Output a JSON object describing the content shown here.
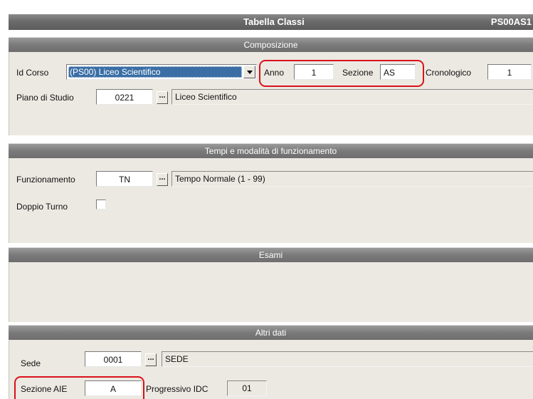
{
  "window": {
    "title": "Tabella Classi",
    "code": "PS00AS1"
  },
  "sections": {
    "composizione": "Composizione",
    "tempi": "Tempi e modalità di funzionamento",
    "esami": "Esami",
    "altri": "Altri dati"
  },
  "composizione": {
    "id_corso_label": "Id Corso",
    "id_corso_value": "(PS00) Liceo Scientifico",
    "anno_label": "Anno",
    "anno_value": "1",
    "sezione_label": "Sezione",
    "sezione_value": "AS",
    "cronologico_label": "Cronologico",
    "cronologico_value": "1",
    "piano_label": "Piano di Studio",
    "piano_code": "0221",
    "piano_desc": "Liceo Scientifico"
  },
  "tempi": {
    "funz_label": "Funzionamento",
    "funz_code": "TN",
    "funz_desc": "Tempo Normale (1 - 99)",
    "doppio_label": "Doppio Turno",
    "doppio_checked": false
  },
  "altri": {
    "sede_label": "Sede",
    "sede_code": "0001",
    "sede_desc": "SEDE",
    "sezione_aie_label": "Sezione AIE",
    "sezione_aie_value": "A",
    "progressivo_label": "Progressivo IDC",
    "progressivo_value": "01"
  },
  "ellipsis": "...",
  "highlight_color": "#d9121b"
}
